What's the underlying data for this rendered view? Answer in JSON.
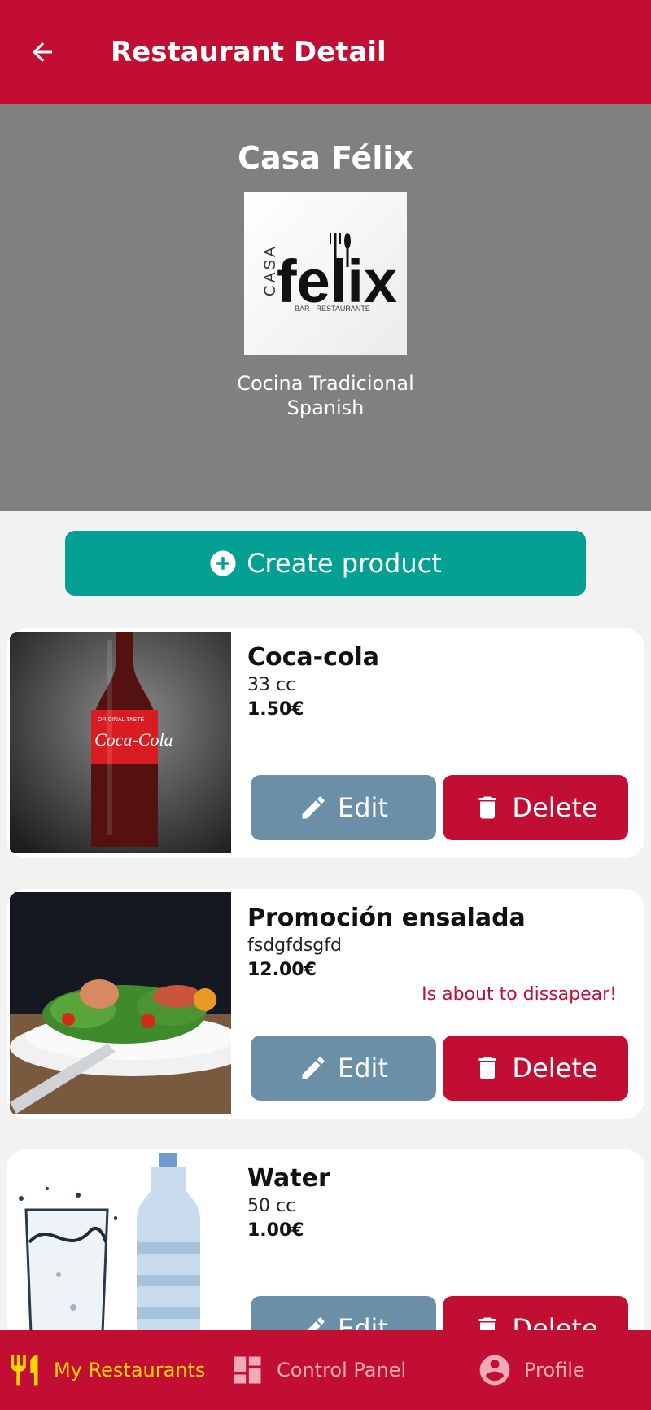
{
  "header": {
    "title": "Restaurant Detail",
    "back_icon": "arrow-left-icon"
  },
  "restaurant": {
    "name": "Casa Félix",
    "description": "Cocina Tradicional",
    "category": "Spanish",
    "logo": {
      "top_word": "CASA",
      "main_word": "felix",
      "tagline": "BAR - RESTAURANTE"
    }
  },
  "actions": {
    "create_product_label": "Create product"
  },
  "products": [
    {
      "name": "Coca-cola",
      "description": "33 cc",
      "price": "1.50€",
      "warning": "",
      "image_text": [
        "ORIGINAL TASTE",
        "Coca-Cola"
      ]
    },
    {
      "name": "Promoción ensalada",
      "description": "fsdgfdsgfd",
      "price": "12.00€",
      "warning": "Is about to dissapear!"
    },
    {
      "name": "Water",
      "description": "50 cc",
      "price": "1.00€",
      "warning": ""
    }
  ],
  "buttons": {
    "edit_label": "Edit",
    "delete_label": "Delete"
  },
  "nav": {
    "items": [
      {
        "label": "My Restaurants",
        "icon": "fork-knife-icon",
        "active": true
      },
      {
        "label": "Control Panel",
        "icon": "dashboard-icon",
        "active": false
      },
      {
        "label": "Profile",
        "icon": "account-circle-icon",
        "active": false
      }
    ]
  },
  "colors": {
    "primary": "#c20e32",
    "accent": "#04a093",
    "edit": "#6a8fa6",
    "nav_active": "#ffd600",
    "hero_bg": "#808080"
  }
}
